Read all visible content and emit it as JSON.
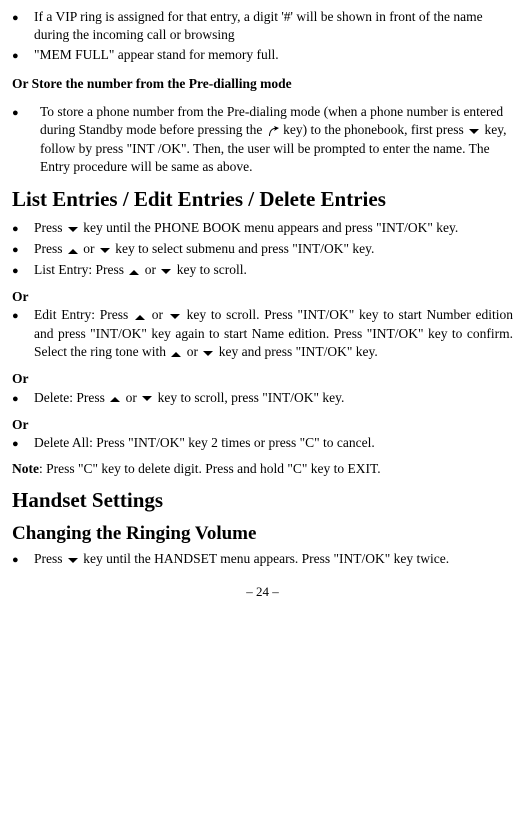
{
  "top_list": {
    "item1": "If a VIP ring is assigned for that entry, a digit '#' will be shown in front of the name during the incoming call or browsing",
    "item2": "\"MEM FULL\" appear stand for memory full."
  },
  "store_heading": "Or Store the number from the Pre-dialling mode",
  "store_item_a": "To store a phone number from the Pre-dialing mode (when a phone number is entered during Standby mode before pressing the ",
  "store_item_b": " key) to the phonebook, first press ",
  "store_item_c": " key, follow by press \"INT /OK\". Then, the user will be prompted to enter the name. The Entry procedure will be same as above.",
  "h1_list": "List Entries / Edit Entries / Delete Entries",
  "list1_a": "Press ",
  "list1_b": " key until the PHONE BOOK menu appears and press \"INT/OK\" key.",
  "list2_a": "Press ",
  "list2_b": " or ",
  "list2_c": " key to select submenu and press \"INT/OK\" key.",
  "list3_a": "List Entry: Press ",
  "list3_b": " or ",
  "list3_c": " key to scroll.",
  "or": "Or",
  "edit_a": "Edit Entry: Press ",
  "edit_b": " or ",
  "edit_c": " key to scroll. Press \"INT/OK\" key to start Number edition and press \"INT/OK\" key again to start Name edition. Press \"INT/OK\" key to confirm. Select the ring tone with ",
  "edit_d": " or ",
  "edit_e": " key and press \"INT/OK\" key.",
  "del_a": "Delete: Press ",
  "del_b": " or ",
  "del_c": " key to scroll, press \"INT/OK\" key.",
  "delall": "Delete All: Press \"INT/OK\" key 2 times or press \"C\" to cancel.",
  "note_label": "Note",
  "note_text": ": Press \"C\" key to delete digit. Press and hold \"C\" key to EXIT.",
  "h1_handset": "Handset Settings",
  "h2_ring": "Changing the Ringing Volume",
  "ring_a": "Press ",
  "ring_b": " key until the HANDSET menu appears. Press \"INT/OK\" key twice.",
  "page": "– 24 –"
}
